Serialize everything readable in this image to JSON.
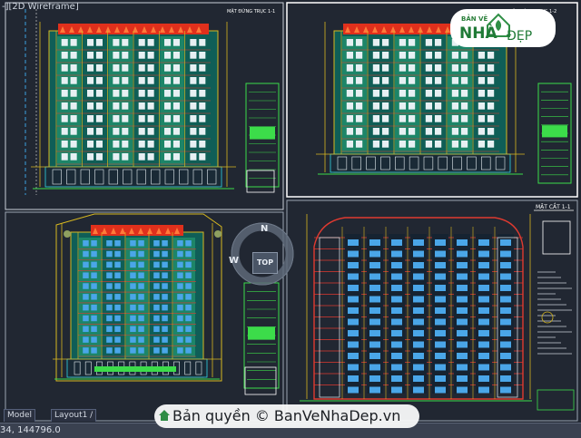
{
  "viewport": {
    "label_prefix": "-][",
    "label_bracket": "2D Wireframe",
    "label_suffix": "]"
  },
  "drawing": {
    "elev_title_main": "MẶT ĐỨNG TRỤC 1-1",
    "elev_title_right": "MẶT ĐỨNG TRỤC 1-2",
    "section_title": "MẶT CẮT 1-1",
    "colors": {
      "background": "#212732",
      "roof_red": "#e0301c",
      "frame_yellow": "#d8b820",
      "glass_green": "#1f8a6a",
      "glass_teal": "#0f5e57",
      "window_white": "#e7f0f3",
      "window_blue": "#4aa6e8",
      "cyan_line": "#30d6e8",
      "red_line": "#e03a30",
      "grid_green": "#3cdc4a"
    }
  },
  "logo": {
    "top_text": "BẢN VẼ",
    "brand": "NHÀ",
    "brand_suffix": "ĐẸP"
  },
  "compass": {
    "top_label": "TOP",
    "north": "N",
    "west": "W"
  },
  "status_bar": {
    "coordinates": "34, 144796.0",
    "tabs": [
      "Model",
      "Layout1 /"
    ]
  },
  "watermark": {
    "text": "Bản quyền © BanVeNhaDep.vn"
  }
}
